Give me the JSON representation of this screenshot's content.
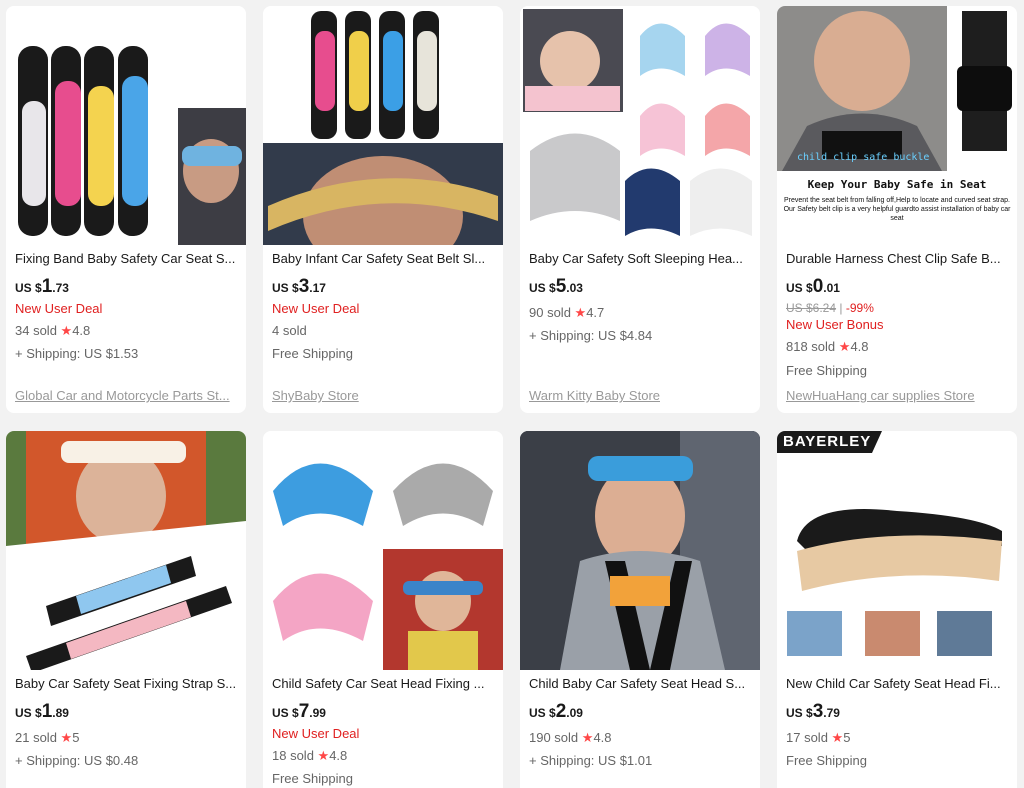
{
  "products": [
    {
      "title": "Fixing Band Baby Safety Car Seat S...",
      "currency": "US $",
      "price_int": "1",
      "price_dec": ".73",
      "deal": "New User Deal",
      "sold": "34 sold",
      "rating": "4.8",
      "shipping": "+ Shipping: US $1.53",
      "store": "Global Car and Motorcycle Parts St..."
    },
    {
      "title": "Baby Infant Car Safety Seat Belt Sl...",
      "currency": "US $",
      "price_int": "3",
      "price_dec": ".17",
      "deal": "New User Deal",
      "sold": "4 sold",
      "shipping": "Free Shipping",
      "store": "ShyBaby Store"
    },
    {
      "title": "Baby Car Safety Soft Sleeping Hea...",
      "currency": "US $",
      "price_int": "5",
      "price_dec": ".03",
      "sold": "90 sold",
      "rating": "4.7",
      "shipping": "+ Shipping: US $4.84",
      "store": "Warm Kitty Baby Store"
    },
    {
      "title": "Durable Harness Chest Clip Safe B...",
      "currency": "US $",
      "price_int": "0",
      "price_dec": ".01",
      "orig_price": "US $6.24",
      "discount": "-99%",
      "deal": "New User Bonus",
      "sold": "818 sold",
      "rating": "4.8",
      "shipping": "Free Shipping",
      "store": "NewHuaHang car supplies Store",
      "image_text": {
        "caption": "Keep Your Baby Safe in Seat",
        "overlay": "child clip safe buckle",
        "desc": "Prevent the seat belt from falling off,Help to locate and curved seat strap. Our Safety belt clip is a very helpful guardto assist installation of baby car seat"
      }
    },
    {
      "title": "Baby Car Safety Seat Fixing Strap S...",
      "currency": "US $",
      "price_int": "1",
      "price_dec": ".89",
      "sold": "21 sold",
      "rating": "5",
      "shipping": "+ Shipping: US $0.48"
    },
    {
      "title": "Child Safety Car Seat Head Fixing ...",
      "currency": "US $",
      "price_int": "7",
      "price_dec": ".99",
      "deal": "New User Deal",
      "sold": "18 sold",
      "rating": "4.8",
      "shipping": "Free Shipping"
    },
    {
      "title": "Child Baby Car Safety Seat Head S...",
      "currency": "US $",
      "price_int": "2",
      "price_dec": ".09",
      "sold": "190 sold",
      "rating": "4.8",
      "shipping": "+ Shipping: US $1.01"
    },
    {
      "title": "New Child Car Safety Seat Head Fi...",
      "currency": "US $",
      "price_int": "3",
      "price_dec": ".79",
      "sold": "17 sold",
      "rating": "5",
      "shipping": "Free Shipping",
      "image_text": {
        "brand": "BAYERLEY"
      }
    }
  ],
  "icons": {
    "star": "★",
    "star_name": "star-icon"
  },
  "colors": {
    "deal_red": "#e02020",
    "star_red": "#ff4747",
    "bg": "#f2f2f2"
  }
}
